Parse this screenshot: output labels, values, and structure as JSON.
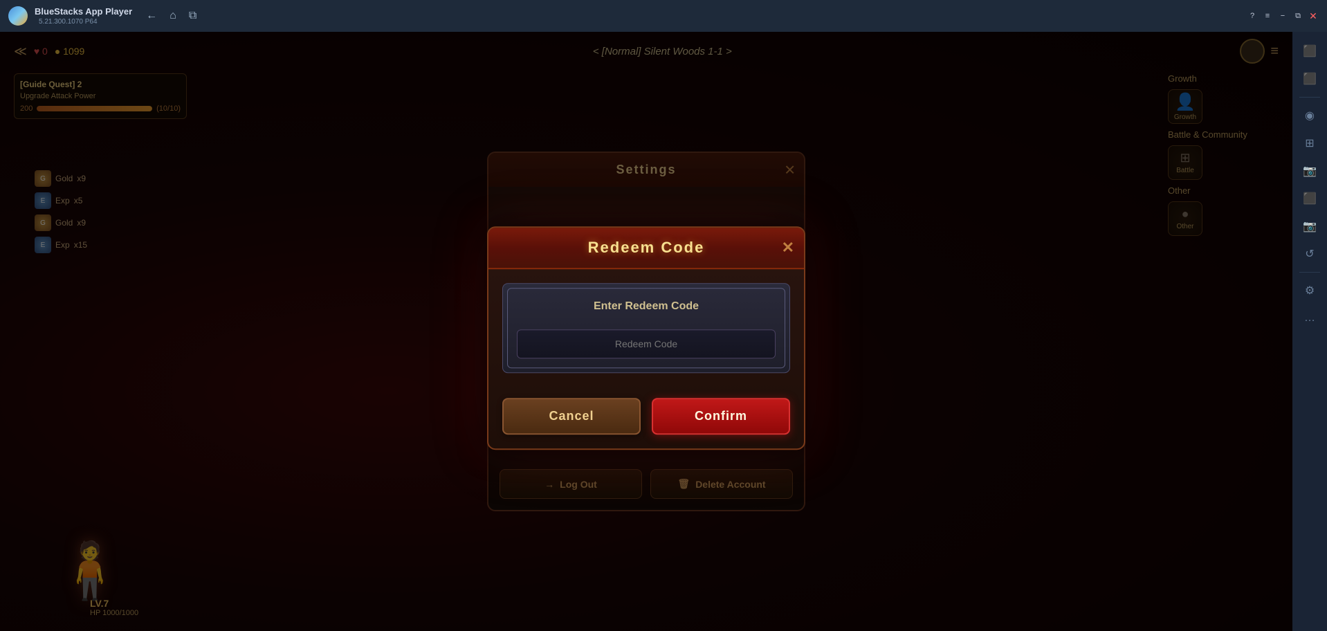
{
  "titlebar": {
    "app_name": "BlueStacks App Player",
    "version": "5.21.300.1070  P64",
    "nav_buttons": [
      "←",
      "⌂",
      "⧉"
    ],
    "window_buttons": [
      "?",
      "≡",
      "−",
      "⧉",
      "✕",
      "✕"
    ]
  },
  "sidebar": {
    "icons": [
      "?",
      "≡",
      "◉",
      "⊞",
      "⊞",
      "📷",
      "⬛",
      "📷",
      "↺",
      "⚙",
      "…"
    ]
  },
  "game_hud": {
    "arrow_icon": "≪",
    "hearts_icon": "♥",
    "hearts_value": "0",
    "coins_icon": "●",
    "coins_value": "1099",
    "stage_text": "< [Normal] Silent Woods 1-1 >",
    "char_level": "7",
    "char_hp": "HP 1000/1000",
    "char_level_label": "LV."
  },
  "quest": {
    "title": "[Guide Quest] 2",
    "description": "Upgrade Attack Power",
    "progress": "200",
    "progress_text": "(10/10)",
    "bar_percent": 100
  },
  "loot_items": [
    {
      "label": "Gold",
      "amount": "x9"
    },
    {
      "label": "Exp",
      "amount": "x5"
    },
    {
      "label": "Gold",
      "amount": "x9"
    },
    {
      "label": "Exp",
      "amount": "x15"
    }
  ],
  "right_panel": {
    "growth_label": "Growth",
    "battle_label": "Battle & Community",
    "other_label": "Other",
    "items": [
      {
        "label": "Growth"
      },
      {
        "label": "Battle"
      },
      {
        "label": "Other"
      }
    ]
  },
  "settings_dialog": {
    "title": "Settings",
    "close_icon": "✕",
    "logout_icon": "→",
    "logout_label": "Log Out",
    "delete_icon": "🗑",
    "delete_label": "Delete Account"
  },
  "redeem_dialog": {
    "title": "Redeem Code",
    "close_icon": "✕",
    "hint_text": "Enter Redeem Code",
    "input_placeholder": "Redeem Code",
    "cancel_label": "Cancel",
    "confirm_label": "Confirm"
  }
}
